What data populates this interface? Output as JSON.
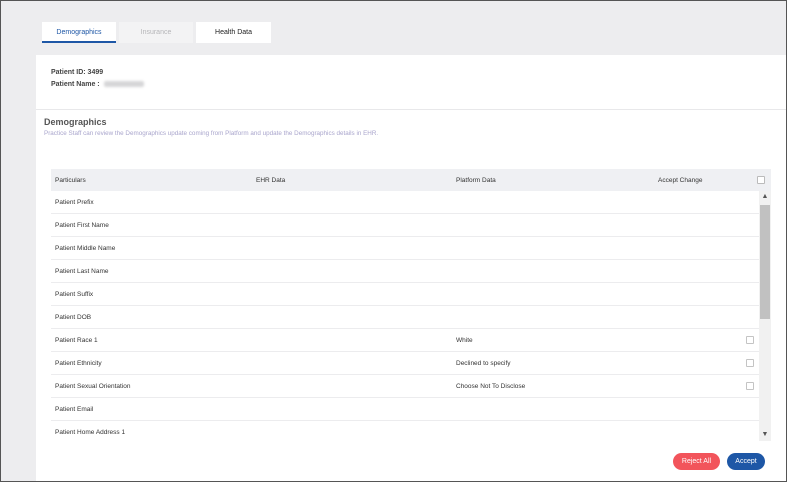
{
  "tabs": [
    {
      "label": "Demographics",
      "state": "active"
    },
    {
      "label": "Insurance",
      "state": "disabled"
    },
    {
      "label": "Health Data",
      "state": "normal"
    }
  ],
  "patient": {
    "id_label": "Patient ID: 3499",
    "name_label": "Patient Name :"
  },
  "section": {
    "title": "Demographics",
    "description": "Practice Staff can review the Demographics update coming from Platform and update the Demographics details in EHR."
  },
  "table": {
    "headers": {
      "particulars": "Particulars",
      "ehr": "EHR Data",
      "platform": "Platform Data",
      "accept": "Accept Change"
    },
    "rows": [
      {
        "particular": "Patient Prefix",
        "ehr": "",
        "platform": "",
        "checkbox": false
      },
      {
        "particular": "Patient First Name",
        "ehr": "",
        "platform": "",
        "checkbox": false
      },
      {
        "particular": "Patient Middle Name",
        "ehr": "",
        "platform": "",
        "checkbox": false
      },
      {
        "particular": "Patient Last Name",
        "ehr": "",
        "platform": "",
        "checkbox": false
      },
      {
        "particular": "Patient Suffix",
        "ehr": "",
        "platform": "",
        "checkbox": false
      },
      {
        "particular": "Patient DOB",
        "ehr": "",
        "platform": "",
        "checkbox": false
      },
      {
        "particular": "Patient Race 1",
        "ehr": "",
        "platform": "White",
        "checkbox": true
      },
      {
        "particular": "Patient Ethnicity",
        "ehr": "",
        "platform": "Declined to specify",
        "checkbox": true
      },
      {
        "particular": "Patient Sexual Orientation",
        "ehr": "",
        "platform": "Choose Not To Disclose",
        "checkbox": true
      },
      {
        "particular": "Patient Email",
        "ehr": "",
        "platform": "",
        "checkbox": false
      },
      {
        "particular": "Patient Home Address 1",
        "ehr": "",
        "platform": "",
        "checkbox": false
      }
    ]
  },
  "buttons": {
    "reject_all": "Reject All",
    "accept": "Accept"
  },
  "colors": {
    "accent": "#1e57a6",
    "reject": "#f2545b",
    "description": "#a9a5cc"
  }
}
